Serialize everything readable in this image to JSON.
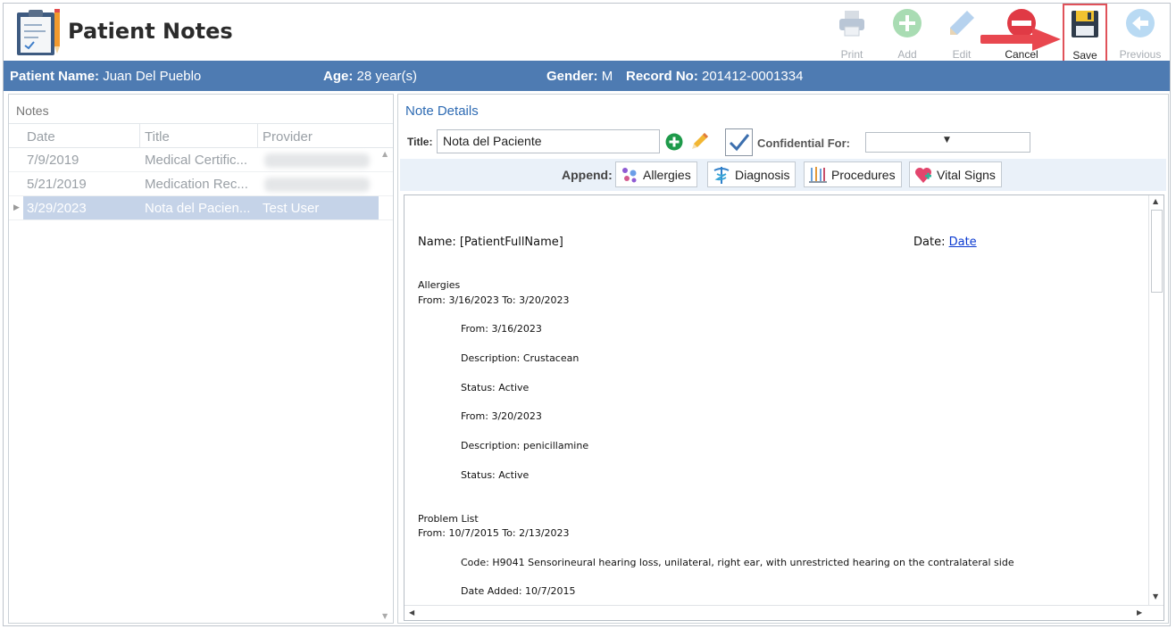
{
  "app": {
    "title": "Patient Notes",
    "icon": "clipboard-notes-icon"
  },
  "toolbar": [
    {
      "id": "print",
      "label": "Print",
      "icon": "printer-icon",
      "enabled": false
    },
    {
      "id": "add",
      "label": "Add",
      "icon": "plus-circle-icon",
      "enabled": false
    },
    {
      "id": "edit",
      "label": "Edit",
      "icon": "pencil-icon",
      "enabled": false
    },
    {
      "id": "cancel",
      "label": "Cancel",
      "icon": "minus-circle-icon",
      "enabled": true
    },
    {
      "id": "save",
      "label": "Save",
      "icon": "floppy-disk-icon",
      "enabled": true,
      "highlighted": true
    },
    {
      "id": "previous",
      "label": "Previous",
      "icon": "arrow-left-circle-icon",
      "enabled": false
    }
  ],
  "patient": {
    "name_label": "Patient Name:",
    "name": "Juan Del Pueblo",
    "age_label": "Age:",
    "age": "28 year(s)",
    "gender_label": "Gender:",
    "gender": "M",
    "record_label": "Record No:",
    "record": "201412-0001334"
  },
  "notes": {
    "caption": "Notes",
    "columns": [
      "Date",
      "Title",
      "Provider"
    ],
    "rows": [
      {
        "date": "7/9/2019",
        "title": "Medical Certific...",
        "provider": "",
        "provider_redacted": true,
        "selected": false
      },
      {
        "date": "5/21/2019",
        "title": "Medication Rec...",
        "provider": "",
        "provider_redacted": true,
        "selected": false
      },
      {
        "date": "3/29/2023",
        "title": "Nota del Pacien...",
        "provider": "Test User",
        "provider_redacted": false,
        "selected": true
      }
    ]
  },
  "details": {
    "caption": "Note Details",
    "title_label": "Title:",
    "title_value": "Nota del Paciente",
    "confidential_label": "Confidential For:",
    "confidential_value": "",
    "confidential_checked": true,
    "append_label": "Append:",
    "append_buttons": [
      {
        "label": "Allergies",
        "icon": "allergies-icon"
      },
      {
        "label": "Diagnosis",
        "icon": "caduceus-icon"
      },
      {
        "label": "Procedures",
        "icon": "surgical-tools-icon"
      },
      {
        "label": "Vital Signs",
        "icon": "heart-pulse-icon"
      }
    ]
  },
  "document": {
    "name_line": "Name: [PatientFullName]",
    "date_label": "Date:",
    "date_link": "Date",
    "allergies_heading": "Allergies",
    "allergies_range": "From: 3/16/2023 To: 3/20/2023",
    "allergy_lines": [
      "From: 3/16/2023",
      "Description: Crustacean",
      "Status: Active",
      "From: 3/20/2023",
      "Description: penicillamine",
      "Status: Active"
    ],
    "problem_heading": "Problem List",
    "problem_range": "From: 10/7/2015 To: 2/13/2023",
    "problem_lines": [
      "Code: H9041 Sensorineural hearing loss, unilateral, right ear, with unrestricted hearing on the contralateral side",
      "Date Added: 10/7/2015"
    ]
  },
  "colors": {
    "patient_bar": "#4e7bb2",
    "selected_row": "#c5d3e8",
    "caption_blue": "#2e6bb3",
    "highlight_border": "#e0525a",
    "arrow_red": "#e8474f"
  }
}
